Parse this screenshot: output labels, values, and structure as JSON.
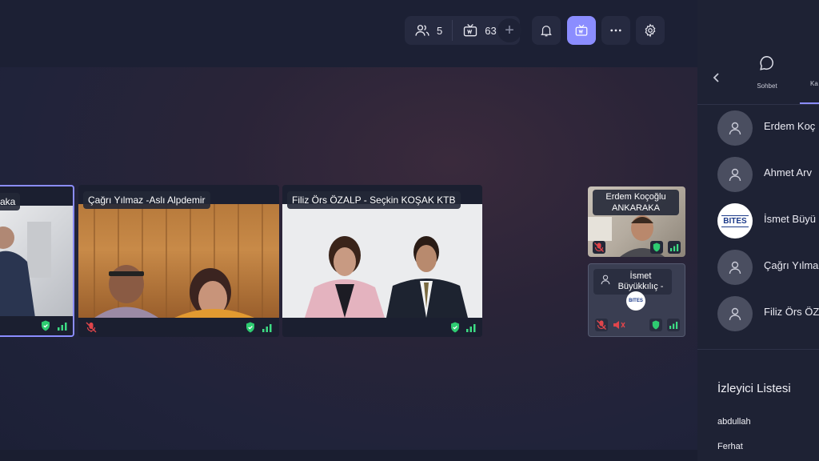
{
  "toolbar": {
    "participants_count": "5",
    "viewers_count": "63",
    "add_label": "+"
  },
  "tiles": [
    {
      "name": "aka"
    },
    {
      "name": "Çağrı Yılmaz -Aslı Alpdemir"
    },
    {
      "name": "Filiz Örs ÖZALP - Seçkin KOŞAK KTB"
    },
    {
      "name": "Erdem Koçoğlu ANKARAKA"
    },
    {
      "name": "İsmet Büyükkılıç -",
      "logo": "BITES"
    }
  ],
  "sidebar": {
    "tab_chat": "Sohbet",
    "tab_participants": "Ka",
    "participants": [
      {
        "name": "Erdem Koç"
      },
      {
        "name": "Ahmet Arv"
      },
      {
        "name": "İsmet Büyü",
        "logo": "BITES"
      },
      {
        "name": "Çağrı Yılma"
      },
      {
        "name": "Filiz Örs ÖZ"
      }
    ],
    "viewer_list_title": "İzleyici Listesi",
    "viewers": [
      "abdullah",
      "Ferhat"
    ]
  },
  "colors": {
    "accent": "#8b8dff",
    "mic_off": "#e0454b",
    "shield": "#2ecc71",
    "signal": "#3ddc84"
  }
}
